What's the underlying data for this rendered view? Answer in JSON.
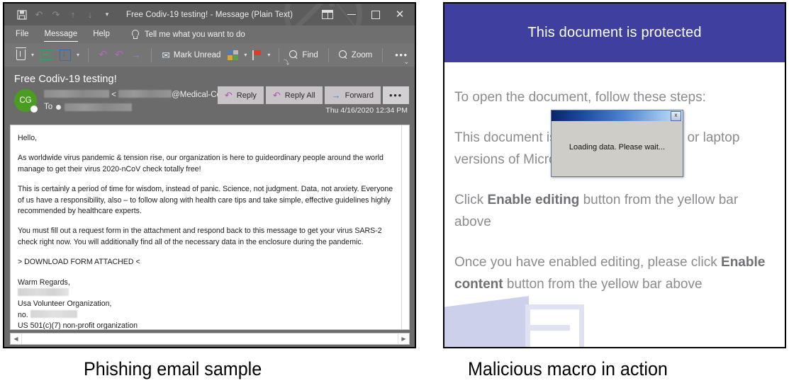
{
  "figure": {
    "caption_left": "Phishing email sample",
    "caption_right": "Malicious macro in action"
  },
  "email_window": {
    "titlebar": {
      "title": "Free Codiv-19 testing!  -  Message (Plain Text)",
      "quick_access": [
        {
          "name": "save-icon",
          "glyph": "💾"
        },
        {
          "name": "undo-icon",
          "glyph": "↶"
        },
        {
          "name": "redo-icon",
          "glyph": "↷"
        },
        {
          "name": "previous-item-icon",
          "glyph": "↑"
        },
        {
          "name": "next-item-icon",
          "glyph": "↓"
        },
        {
          "name": "customize-quick-access-toolbar-icon",
          "glyph": "⌄"
        }
      ],
      "window_controls": {
        "ribbon_display_options": "ribbon-display-options-icon",
        "minimize": "minimize-icon",
        "maximize": "maximize-icon",
        "close": "✕"
      }
    },
    "menu": {
      "items": [
        {
          "label": "File",
          "active": false
        },
        {
          "label": "Message",
          "active": true
        },
        {
          "label": "Help",
          "active": false
        }
      ],
      "tell_me": "Tell me what you want to do",
      "tell_me_icon": "lightbulb-icon"
    },
    "toolbar": {
      "delete_label": "",
      "archive_label": "",
      "move_to_label": "",
      "undo_label": "",
      "reply_all_label": "",
      "forward_label": "",
      "mark_unread_label": "Mark Unread",
      "categorize_label": "",
      "follow_up_label": "",
      "find_label": "Find",
      "zoom_label": "Zoom",
      "more_label": "•••",
      "dialog_launcher": "⤵",
      "ribbon_collapse": "⌄"
    },
    "message": {
      "subject": "Free Codiv-19 testing!",
      "avatar_initials": "CG",
      "sender_redacted_prefix": "",
      "sender_angle_open": "<",
      "sender_domain": "@Medical-Center",
      "to_label": "To",
      "date": "Thu 4/16/2020 12:34 PM",
      "actions": [
        {
          "label": "Reply",
          "icon": "reply-icon",
          "glyph": "↶"
        },
        {
          "label": "Reply All",
          "icon": "reply-all-icon",
          "glyph": "↶"
        },
        {
          "label": "Forward",
          "icon": "forward-icon",
          "glyph": "→"
        },
        {
          "label": "•••",
          "icon": "more-actions-icon",
          "glyph": ""
        }
      ],
      "body_paragraphs": [
        "Hello,",
        "As worldwide virus pandemic & tension rise, our organization is here to guideordinary people around the world manage to get their  virus 2020-nCoV check totally free!",
        "This is certainly a period of time for wisdom, instead of panic. Science, not judgment. Data, not anxiety. Everyone of us have a responsibility, also – to follow along with health care tips and take simple, effective guidelines highly recommended by healthcare experts.",
        "You must fill out a request form in the attachment and respond back to this message to get your virus SARS-2 check right now. You will additionally find all of the necessary data in the enclosure during the pandemic.",
        "> DOWNLOAD FORM ATTACHED <"
      ],
      "signature": {
        "closing": "Warm Regards,",
        "name_redacted": "",
        "organization": "Usa Volunteer Organization,",
        "number_label": "no.",
        "number_redacted": "",
        "legal": "US 501(c)(7) non-profit organization"
      }
    },
    "scrollbar": {
      "left_arrow": "◀",
      "right_arrow": "▶"
    }
  },
  "document_window": {
    "banner_text": "This document is protected",
    "banner_color": "#3f3fa0",
    "paragraphs": [
      {
        "id": "p1",
        "text": "To open the document, follow these steps:"
      },
      {
        "id": "p2",
        "text": "This document is available for desktop or laptop versions of Microsoft Office Word"
      },
      {
        "id": "p3_pre",
        "text": "Click "
      },
      {
        "id": "p3_bold",
        "text": "Enable editing"
      },
      {
        "id": "p3_post",
        "text": " button from the yellow bar above"
      },
      {
        "id": "p4_pre",
        "text": "Once you have enabled editing, please click "
      },
      {
        "id": "p4_bold",
        "text": "Enable content"
      },
      {
        "id": "p4_post",
        "text": " button from the yellow bar above"
      }
    ],
    "decoration": "document-illustration"
  },
  "loading_dialog": {
    "message": "Loading data. Please wait...",
    "close_label": "x",
    "title": ""
  }
}
